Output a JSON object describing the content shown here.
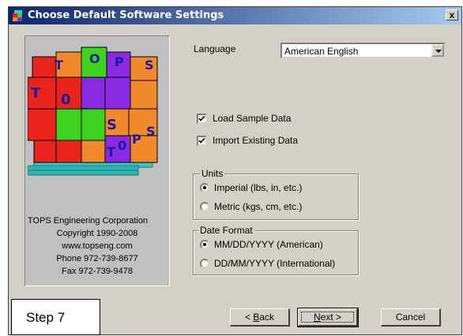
{
  "window": {
    "title": "Choose Default Software Settings",
    "close_glyph": "x"
  },
  "logo": {
    "cube_letters": [
      "T",
      "O",
      "P",
      "S"
    ]
  },
  "company": {
    "name": "TOPS Engineering Corporation",
    "copyright": "Copyright 1990-2008",
    "website": "www.topseng.com",
    "phone": "Phone 972-739-8677",
    "fax": "Fax 972-739-9478"
  },
  "settings": {
    "language_label": "Language",
    "language_value": "American English",
    "load_sample": {
      "label": "Load Sample Data",
      "checked": true
    },
    "import_existing": {
      "label": "Import Existing Data",
      "checked": true
    },
    "units": {
      "label": "Units",
      "options": [
        "Imperial (lbs, in, etc.)",
        "Metric (kgs, cm, etc.)"
      ],
      "selected": "Imperial (lbs, in, etc.)"
    },
    "date_format": {
      "label": "Date Format",
      "options": [
        "MM/DD/YYYY (American)",
        "DD/MM/YYYY (International)"
      ],
      "selected": "MM/DD/YYYY (American)"
    }
  },
  "buttons": {
    "back_prefix": "< ",
    "back_mnemonic": "B",
    "back_rest": "ack",
    "next_mnemonic": "N",
    "next_rest": "ext >",
    "cancel": "Cancel"
  },
  "step_label": "Step 7",
  "colors": {
    "title_start": "#0a246a",
    "title_end": "#a6caf0",
    "dialog_bg": "#d4d0c8",
    "cube_red": "#e8241c",
    "cube_green": "#3fd21e",
    "cube_purple": "#8a2be2",
    "cube_orange": "#f08a2c",
    "pallet": "#3cc8c8"
  }
}
